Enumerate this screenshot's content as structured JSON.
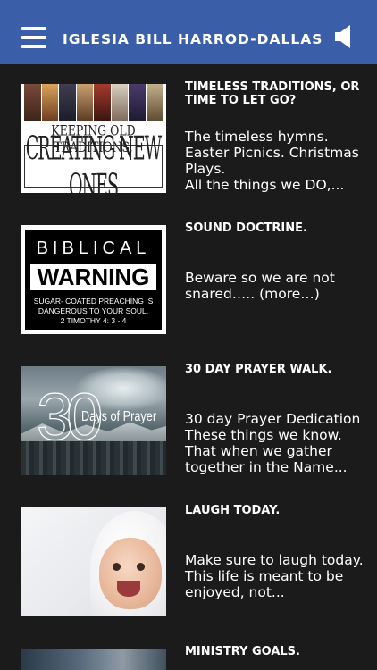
{
  "header": {
    "title": "IGLESIA BILL HARROD-DALLAS",
    "menu_icon": "hamburger-menu-icon",
    "audio_icon": "speaker-icon",
    "background": "#3a5ea8"
  },
  "posts": [
    {
      "title": "TIMELESS TRADITIONS, OR TIME TO LET GO?",
      "excerpt": "The timeless hymns. Easter Picnics. Christmas Plays.\nAll the things we DO,...",
      "thumb_text_1": "KEEPING OLD TRADITIONS,",
      "thumb_text_2": "CREATING NEW ONES"
    },
    {
      "title": "SOUND DOCTRINE.",
      "excerpt": "Beware so we are not snared….. (more…)",
      "thumb_text_1": "BIBLICAL",
      "thumb_text_2": "WARNING",
      "thumb_text_3": "SUGAR- COATED PREACHING IS DANGEROUS TO YOUR SOUL.\n2 TIMOTHY 4: 3 - 4"
    },
    {
      "title": "30 DAY PRAYER WALK.",
      "excerpt": "30 day Prayer Dedication\nThese things we know.\nThat when we gather together in the Name...",
      "thumb_text_1": "30",
      "thumb_text_2": "Days of Prayer"
    },
    {
      "title": "LAUGH TODAY.",
      "excerpt": "Make sure to laugh today.\nThis life is meant to be enjoyed, not..."
    },
    {
      "title": "MINISTRY GOALS.",
      "excerpt": ""
    }
  ]
}
